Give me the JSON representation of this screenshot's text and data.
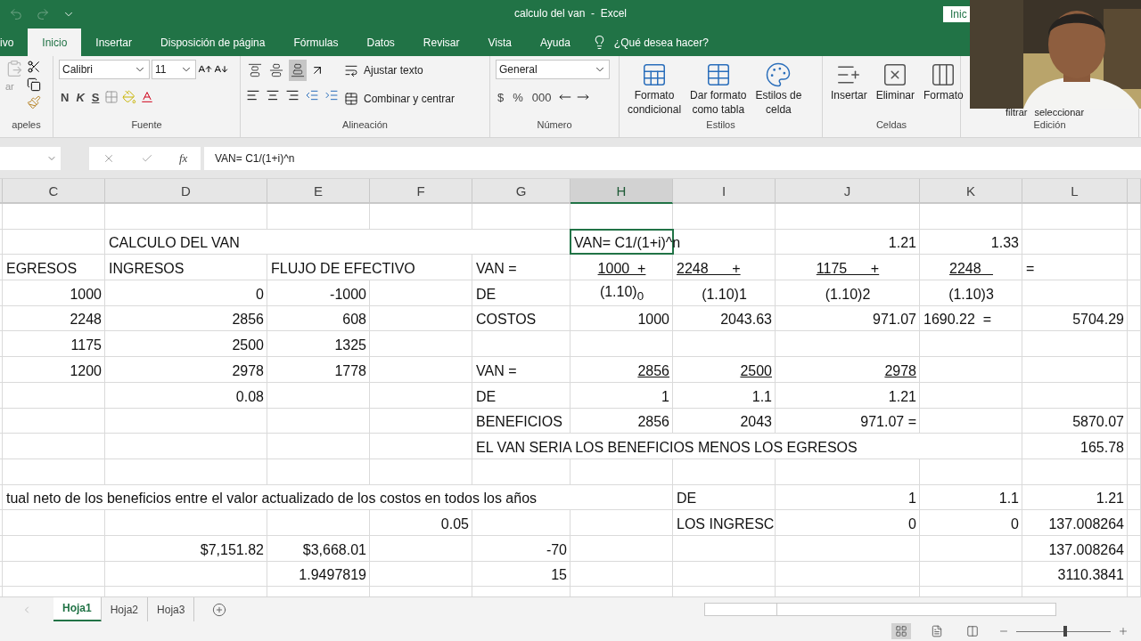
{
  "title_bar": {
    "title": "calculo del van  -  Excel",
    "sign_in": "Inic"
  },
  "menu_tabs": [
    {
      "label": "ivo",
      "selected": false
    },
    {
      "label": "Inicio",
      "selected": true
    },
    {
      "label": "Insertar",
      "selected": false
    },
    {
      "label": "Disposición de página",
      "selected": false
    },
    {
      "label": "Fórmulas",
      "selected": false
    },
    {
      "label": "Datos",
      "selected": false
    },
    {
      "label": "Revisar",
      "selected": false
    },
    {
      "label": "Vista",
      "selected": false
    },
    {
      "label": "Ayuda",
      "selected": false
    }
  ],
  "tell_me": "¿Qué desea hacer?",
  "ribbon": {
    "clipboard": {
      "paste": "ar",
      "label": "apeles"
    },
    "font": {
      "name": "Calibri",
      "size": "11",
      "bold": "N",
      "italic": "K",
      "underline": "S",
      "label": "Fuente"
    },
    "alignment": {
      "vertical": [
        {
          "selected": false
        },
        {
          "selected": false
        },
        {
          "selected": true
        }
      ],
      "wrap": "Ajustar texto",
      "merge": "Combinar y centrar",
      "label": "Alineación"
    },
    "number": {
      "format": "General",
      "currency": "$",
      "percent": "%",
      "thousands": "000",
      "label": "Número"
    },
    "styles": {
      "buttons": [
        {
          "line1": "Formato",
          "line2": "condicional"
        },
        {
          "line1": "Dar formato",
          "line2": "como tabla"
        },
        {
          "line1": "Estilos de",
          "line2": "celda"
        }
      ],
      "label": "Estilos"
    },
    "cells": {
      "buttons": [
        "Insertar",
        "Eliminar",
        "Formato"
      ],
      "label": "Celdas"
    },
    "editing": {
      "buttons": [
        "filtrar",
        "seleccionar"
      ],
      "label": "Edición"
    }
  },
  "formula_bar": {
    "function_label": "fx",
    "formula": "VAN= C1/(1+i)^n"
  },
  "sheet": {
    "columns": [
      {
        "label": "C",
        "selected": false
      },
      {
        "label": "D",
        "selected": false
      },
      {
        "label": "E",
        "selected": false
      },
      {
        "label": "F",
        "selected": false
      },
      {
        "label": "G",
        "selected": false
      },
      {
        "label": "H",
        "selected": true
      },
      {
        "label": "I",
        "selected": false
      },
      {
        "label": "J",
        "selected": false
      },
      {
        "label": "K",
        "selected": false
      },
      {
        "label": "L",
        "selected": false
      }
    ],
    "rows": [
      [],
      [
        "",
        {
          "text": "CALCULO DEL VAN",
          "kind": "label",
          "selected": false
        },
        "",
        "",
        "",
        {
          "text": "VAN= C1/(1+i)^n",
          "kind": "label",
          "selected": true
        },
        "",
        {
          "text": "1.21",
          "kind": "number",
          "selected": false
        },
        {
          "text": "1.33",
          "kind": "number",
          "selected": false
        },
        ""
      ],
      [
        {
          "text": "EGRESOS",
          "kind": "label",
          "selected": false
        },
        {
          "text": "INGRESOS",
          "kind": "label",
          "selected": false
        },
        {
          "text": "FLUJO DE EFECTIVO",
          "kind": "label",
          "selected": false
        },
        "",
        {
          "text": "VAN =",
          "kind": "label",
          "selected": false
        },
        {
          "text": "1000  +",
          "kind": "centered",
          "underline": true,
          "selected": false
        },
        {
          "text": "2248      +",
          "kind": "label",
          "underline": true,
          "selected": false
        },
        {
          "text": "1175      +",
          "kind": "centered",
          "underline": true,
          "selected": false
        },
        {
          "text": "2248   ",
          "kind": "centered",
          "underline": true,
          "selected": false
        },
        {
          "text": "=",
          "kind": "label",
          "selected": false
        }
      ],
      [
        {
          "text": "1000",
          "kind": "number",
          "selected": false
        },
        {
          "text": "0",
          "kind": "number",
          "selected": false
        },
        {
          "text": "-1000",
          "kind": "number",
          "selected": false
        },
        "",
        {
          "text": "DE",
          "kind": "label",
          "selected": false
        },
        {
          "text": "(1.10)$_{0}$",
          "kind": "centered",
          "selected": false
        },
        {
          "text": "(1.10)1",
          "kind": "centered",
          "selected": false
        },
        {
          "text": "(1.10)2",
          "kind": "centered",
          "selected": false
        },
        {
          "text": "(1.10)3",
          "kind": "centered",
          "selected": false
        },
        ""
      ],
      [
        {
          "text": "2248",
          "kind": "number",
          "selected": false
        },
        {
          "text": "2856",
          "kind": "number",
          "selected": false
        },
        {
          "text": "608",
          "kind": "number",
          "selected": false
        },
        "",
        {
          "text": "COSTOS",
          "kind": "label",
          "selected": false
        },
        {
          "text": "1000",
          "kind": "number",
          "selected": false
        },
        {
          "text": "2043.63",
          "kind": "number",
          "selected": false
        },
        {
          "text": "971.07",
          "kind": "number",
          "selected": false
        },
        {
          "text": "1690.22  =",
          "kind": "label",
          "selected": false
        },
        {
          "text": "5704.29",
          "kind": "number",
          "selected": false
        }
      ],
      [
        {
          "text": "1175",
          "kind": "number",
          "selected": false
        },
        {
          "text": "2500",
          "kind": "number",
          "selected": false
        },
        {
          "text": "1325",
          "kind": "number",
          "selected": false
        }
      ],
      [
        {
          "text": "1200",
          "kind": "number",
          "selected": false
        },
        {
          "text": "2978",
          "kind": "number",
          "selected": false
        },
        {
          "text": "1778",
          "kind": "number",
          "selected": false
        },
        "",
        {
          "text": "VAN =",
          "kind": "label",
          "selected": false
        },
        {
          "text": "2856",
          "kind": "number",
          "underline": true,
          "selected": false
        },
        {
          "text": "2500",
          "kind": "number",
          "underline": true,
          "selected": false
        },
        {
          "text": "2978",
          "kind": "number",
          "underline": true,
          "selected": false
        }
      ],
      [
        "",
        {
          "text": "0.08",
          "kind": "number",
          "selected": false
        },
        "",
        "",
        {
          "text": "DE",
          "kind": "label",
          "selected": false
        },
        {
          "text": "1",
          "kind": "number",
          "selected": false
        },
        {
          "text": "1.1",
          "kind": "number",
          "selected": false
        },
        {
          "text": "1.21",
          "kind": "number",
          "selected": false
        }
      ],
      [
        "",
        "",
        "",
        "",
        {
          "text": "BENEFICIOS",
          "kind": "label",
          "selected": false
        },
        {
          "text": "2856",
          "kind": "number",
          "selected": false
        },
        {
          "text": "2043",
          "kind": "number",
          "selected": false
        },
        {
          "text": "971.07 =",
          "kind": "number",
          "selected": false
        },
        "",
        {
          "text": "5870.07",
          "kind": "number",
          "selected": false
        }
      ],
      [
        "",
        "",
        "",
        "",
        {
          "text": "EL VAN SERIA LOS BENEFICIOS MENOS LOS EGRESOS",
          "kind": "label",
          "selected": false
        },
        "",
        "",
        "",
        "",
        {
          "text": "165.78",
          "kind": "number",
          "selected": false
        }
      ],
      [],
      [
        {
          "text": "tual neto de los beneficios entre el valor actualizado de los costos en todos los años",
          "kind": "label",
          "selected": false
        },
        "",
        "",
        "",
        "",
        "",
        {
          "text": "DE",
          "kind": "label",
          "selected": false
        },
        {
          "text": "1",
          "kind": "number",
          "selected": false
        },
        {
          "text": "1.1",
          "kind": "number",
          "selected": false
        },
        {
          "text": "1.21",
          "kind": "number",
          "selected": false
        }
      ],
      [
        "",
        "",
        "",
        {
          "text": "0.05",
          "kind": "number",
          "selected": false
        },
        "",
        "",
        {
          "text": "LOS INGRESC",
          "kind": "label",
          "selected": false
        },
        {
          "text": "0",
          "kind": "number",
          "selected": false
        },
        {
          "text": "0",
          "kind": "number",
          "selected": false
        },
        {
          "text": "137.008264",
          "kind": "number",
          "selected": false
        }
      ],
      [
        "",
        {
          "text": "$7,151.82",
          "kind": "number",
          "selected": false
        },
        {
          "text": "$3,668.01",
          "kind": "number",
          "selected": false
        },
        "",
        {
          "text": "-70",
          "kind": "number",
          "selected": false
        },
        "",
        "",
        "",
        "",
        {
          "text": "137.008264",
          "kind": "number",
          "selected": false
        }
      ],
      [
        "",
        "",
        {
          "text": "1.9497819",
          "kind": "number",
          "selected": false
        },
        "",
        {
          "text": "15",
          "kind": "number",
          "selected": false
        },
        "",
        "",
        "",
        "",
        {
          "text": "3110.3841",
          "kind": "number",
          "selected": false
        }
      ],
      []
    ]
  },
  "sheet_tabs": [
    {
      "label": "Hoja1",
      "selected": true
    },
    {
      "label": "Hoja2",
      "selected": false
    },
    {
      "label": "Hoja3",
      "selected": false
    }
  ],
  "status_bar": {
    "views": [
      {
        "selected": true
      },
      {
        "selected": false
      },
      {
        "selected": false
      }
    ],
    "zoom": {
      "level": 0.52
    }
  }
}
